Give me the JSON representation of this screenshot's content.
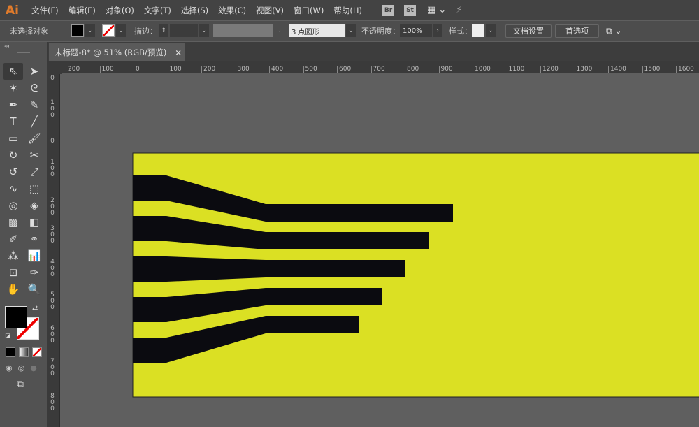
{
  "app": {
    "logo": "Ai"
  },
  "menu": [
    "文件(F)",
    "编辑(E)",
    "对象(O)",
    "文字(T)",
    "选择(S)",
    "效果(C)",
    "视图(V)",
    "窗口(W)",
    "帮助(H)"
  ],
  "menu_icons": {
    "bridge": "Br",
    "stock": "St"
  },
  "control": {
    "selection": "未选择对象",
    "stroke_label": "描边：",
    "brush": "3 点圆形",
    "opacity_label": "不透明度：",
    "opacity": "100%",
    "style_label": "样式：",
    "doc_setup": "文档设置",
    "preferences": "首选项"
  },
  "colors": {
    "artboard": "#dbe023",
    "shape": "#0b0b10",
    "fill": "#000000"
  },
  "tab": {
    "title": "未标题-8* @ 51% (RGB/预览)",
    "close": "×"
  },
  "hruler": [
    "200",
    "100",
    "0",
    "100",
    "200",
    "300",
    "400",
    "500",
    "600",
    "700",
    "800",
    "900",
    "1000",
    "1100",
    "1200",
    "1300",
    "1400",
    "1500",
    "1600"
  ],
  "vruler": [
    "0",
    "100",
    "0",
    "100",
    "200",
    "300",
    "400",
    "500",
    "600",
    "700",
    "800"
  ]
}
